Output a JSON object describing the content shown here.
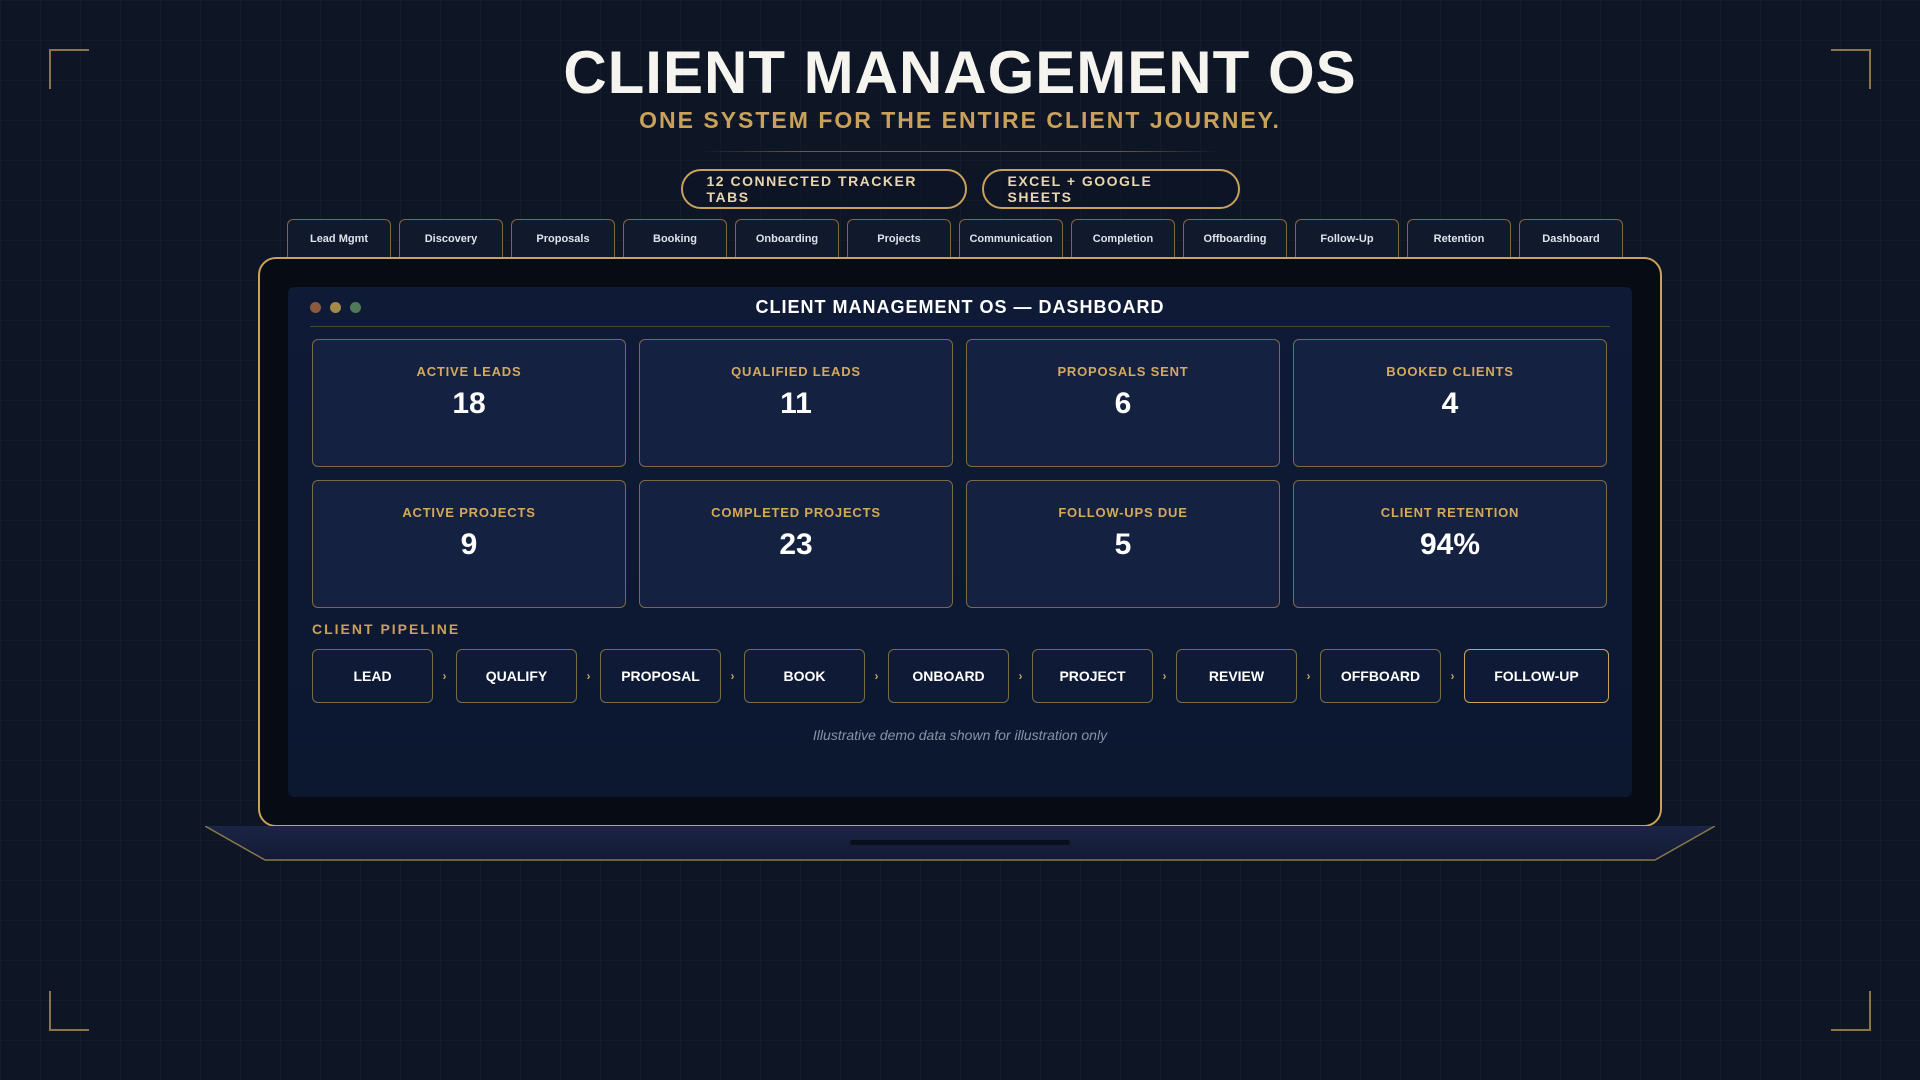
{
  "hero": {
    "title": "CLIENT MANAGEMENT OS",
    "subtitle": "ONE SYSTEM FOR THE ENTIRE CLIENT JOURNEY.",
    "pills": [
      "12 CONNECTED TRACKER TABS",
      "EXCEL + GOOGLE SHEETS"
    ]
  },
  "tabs": [
    "Lead Mgmt",
    "Discovery",
    "Proposals",
    "Booking",
    "Onboarding",
    "Projects",
    "Communication",
    "Completion",
    "Offboarding",
    "Follow-Up",
    "Retention",
    "Dashboard"
  ],
  "dashboard": {
    "title": "CLIENT MANAGEMENT OS — DASHBOARD",
    "stats": [
      {
        "label": "ACTIVE LEADS",
        "value": "18"
      },
      {
        "label": "QUALIFIED LEADS",
        "value": "11"
      },
      {
        "label": "PROPOSALS SENT",
        "value": "6"
      },
      {
        "label": "BOOKED CLIENTS",
        "value": "4"
      },
      {
        "label": "ACTIVE PROJECTS",
        "value": "9"
      },
      {
        "label": "COMPLETED PROJECTS",
        "value": "23"
      },
      {
        "label": "FOLLOW-UPS DUE",
        "value": "5"
      },
      {
        "label": "CLIENT RETENTION",
        "value": "94%"
      }
    ],
    "pipeline_heading": "CLIENT PIPELINE",
    "pipeline": [
      "LEAD",
      "QUALIFY",
      "PROPOSAL",
      "BOOK",
      "ONBOARD",
      "PROJECT",
      "REVIEW",
      "OFFBOARD",
      "FOLLOW-UP"
    ],
    "arrow_glyph": "›",
    "footnote": "Illustrative demo data shown for illustration only"
  },
  "colors": {
    "background": "#0e1626",
    "accent_gold": "#c9a15a",
    "card_bg": "#142140",
    "screen_bg": "#0f1b36"
  }
}
